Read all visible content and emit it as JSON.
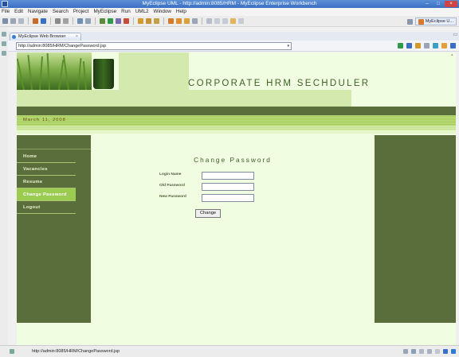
{
  "window": {
    "title": "MyEclipse UML - http://admin:8085/HRM - MyEclipse Enterprise Workbench",
    "minimize": "–",
    "maximize": "□",
    "close": "×"
  },
  "menu": [
    "File",
    "Edit",
    "Navigate",
    "Search",
    "Project",
    "MyEclipse",
    "Run",
    "UML2",
    "Window",
    "Help"
  ],
  "perspective": {
    "label": "MyEclipse U..."
  },
  "editor": {
    "tab_label": "MyEclipse Web Browser"
  },
  "urlbar": {
    "url": "http://admin:8085/HRM/ChangePassword.jsp"
  },
  "page": {
    "header_title": "CORPORATE HRM SECHDULER",
    "date": "March 11, 2008",
    "nav": [
      {
        "label": "Home"
      },
      {
        "label": "Vacancies"
      },
      {
        "label": "Resume"
      },
      {
        "label": "Change Password"
      },
      {
        "label": "Logout"
      }
    ],
    "form": {
      "title": "Change Password",
      "login_label": "Login Name",
      "old_label": "Old Password",
      "new_label": "New Password",
      "button": "Change"
    }
  },
  "status": {
    "text": "http://admin:8085/HRM/ChangePassword.jsp"
  },
  "colors": {
    "sidebar": "#5a6e3c",
    "active_nav": "#9ccb52",
    "page_bg": "#f1fde1",
    "title_text": "#3f5f28"
  }
}
